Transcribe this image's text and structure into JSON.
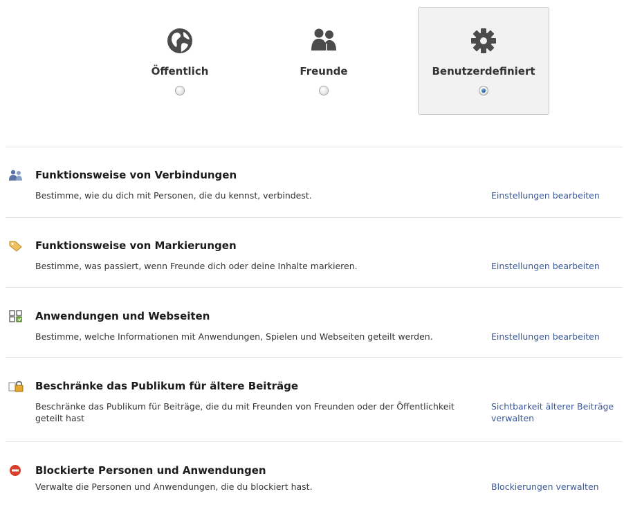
{
  "audience_options": [
    {
      "label": "Öffentlich",
      "icon": "globe-icon",
      "selected": false
    },
    {
      "label": "Freunde",
      "icon": "friends-icon",
      "selected": false
    },
    {
      "label": "Benutzerdefiniert",
      "icon": "gear-icon",
      "selected": true
    }
  ],
  "sections": [
    {
      "icon": "friends-icon",
      "title": "Funktionsweise von Verbindungen",
      "description": "Bestimme, wie du dich mit Personen, die du kennst, verbindest.",
      "link": "Einstellungen bearbeiten"
    },
    {
      "icon": "tag-icon",
      "title": "Funktionsweise von Markierungen",
      "description": "Bestimme, was passiert, wenn Freunde dich oder deine Inhalte markieren.",
      "link": "Einstellungen bearbeiten"
    },
    {
      "icon": "apps-icon",
      "title": "Anwendungen und Webseiten",
      "description": "Bestimme, welche Informationen mit Anwendungen, Spielen und Webseiten geteilt werden.",
      "link": "Einstellungen bearbeiten"
    },
    {
      "icon": "lock-icon",
      "title": "Beschränke das Publikum für ältere Beiträge",
      "description": "Beschränke das Publikum für Beiträge, die du mit Freunden von Freunden oder der Öffentlichkeit geteilt hast",
      "link": "Sichtbarkeit älterer Beiträge verwalten"
    },
    {
      "icon": "block-icon",
      "title": "Blockierte Personen und Anwendungen",
      "description": "Verwalte die Personen und Anwendungen, die du blockiert hast.",
      "link": "Blockierungen verwalten"
    }
  ]
}
